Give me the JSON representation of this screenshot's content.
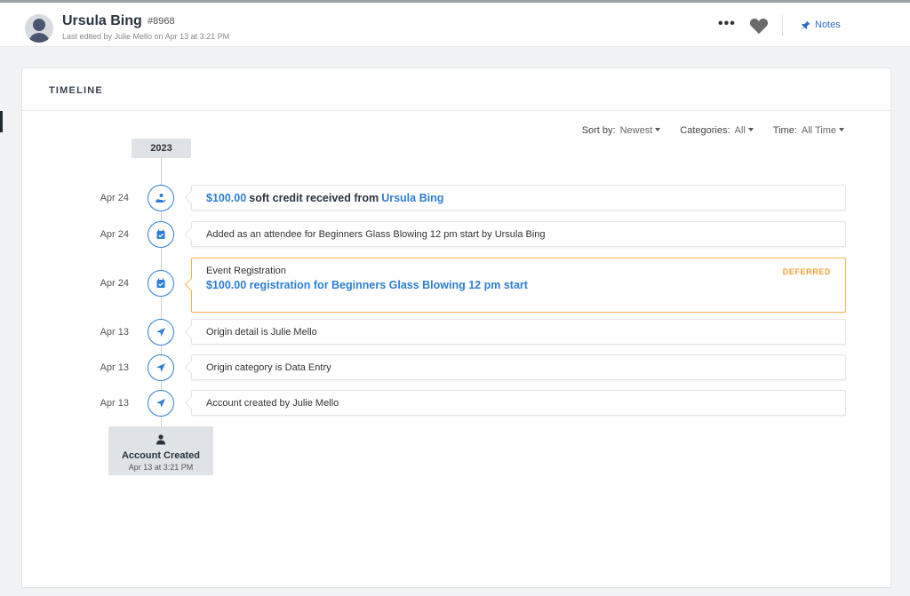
{
  "header": {
    "name": "Ursula Bing",
    "id": "#8968",
    "last_edited": "Last edited by Julie Mello on Apr 13 at 3:21 PM",
    "more_label": "•••",
    "notes_label": "Notes",
    "icons": {
      "avatar": "person-avatar",
      "favorite": "heart-icon",
      "notes": "pin-icon"
    }
  },
  "timeline": {
    "title": "TIMELINE",
    "filters": {
      "sort_label": "Sort by:",
      "sort_value": "Newest",
      "categories_label": "Categories:",
      "categories_value": "All",
      "time_label": "Time:",
      "time_value": "All Time"
    },
    "year": "2023",
    "items": [
      {
        "date": "Apr 24",
        "icon": "donation-hand-icon",
        "amount": "$100.00",
        "text": "soft credit received from",
        "link": "Ursula Bing"
      },
      {
        "date": "Apr 24",
        "icon": "calendar-check-icon",
        "text": "Added as an attendee for Beginners Glass Blowing 12 pm start by Ursula Bing"
      },
      {
        "date": "Apr 24",
        "icon": "calendar-check-icon",
        "title": "Event Registration",
        "description": "$100.00 registration for Beginners Glass Blowing 12 pm start",
        "status": "DEFERRED"
      },
      {
        "date": "Apr 13",
        "icon": "location-arrow-icon",
        "text": "Origin detail is Julie Mello"
      },
      {
        "date": "Apr 13",
        "icon": "location-arrow-icon",
        "text": "Origin category is Data Entry"
      },
      {
        "date": "Apr 13",
        "icon": "location-arrow-icon",
        "text": "Account created by Julie Mello"
      }
    ],
    "account_created": {
      "label": "Account Created",
      "date": "Apr 13 at 3:21 PM",
      "icon": "person-icon"
    }
  },
  "colors": {
    "accent": "#2d7ed6",
    "deferred": "#f0a030",
    "badge_bg": "#dfe3e8"
  }
}
